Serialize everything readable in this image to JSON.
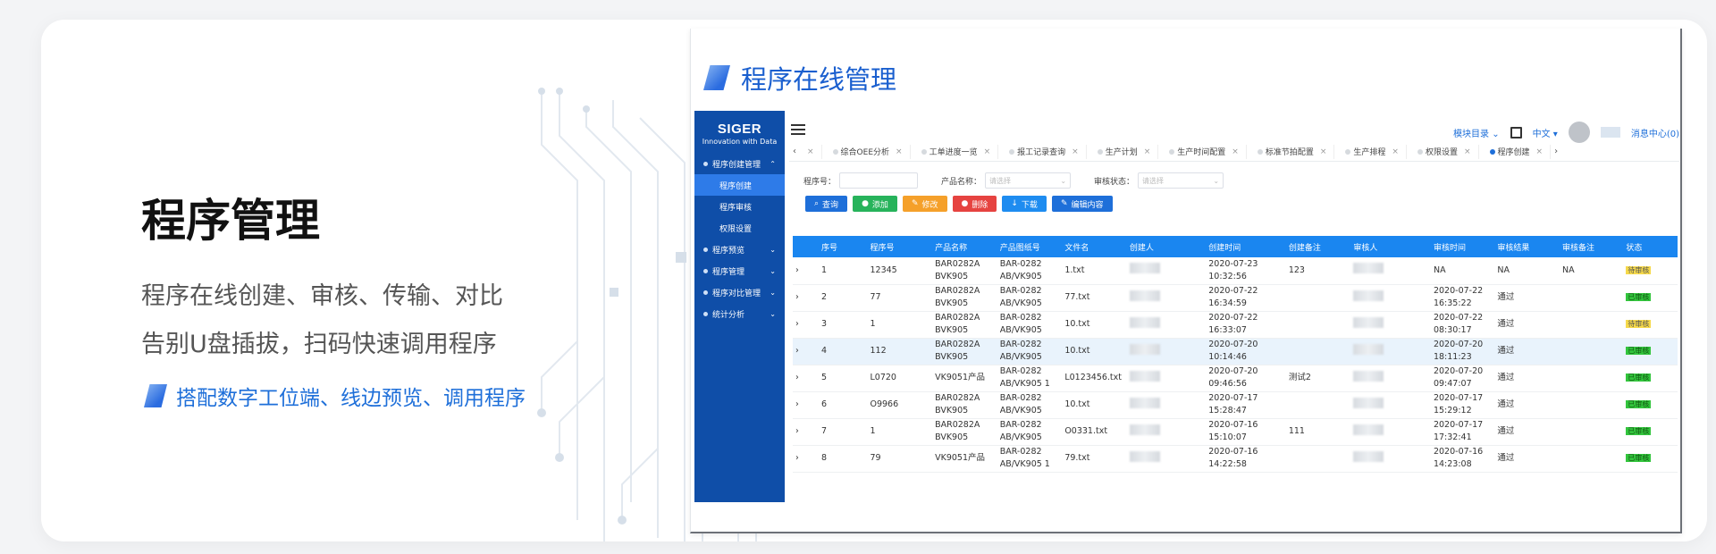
{
  "left": {
    "title": "程序管理",
    "desc_line1": "程序在线创建、审核、传输、对比",
    "desc_line2": "告别U盘插拔，扫码快速调用程序",
    "tagline": "搭配数字工位端、线边预览、调用程序"
  },
  "shot": {
    "title": "程序在线管理",
    "logo_main": "SIGER",
    "logo_sub": "Innovation with Data",
    "sidebar": [
      {
        "label": "程序创建管理",
        "expand": true
      },
      {
        "label": "程序创建",
        "sub": true,
        "active": true
      },
      {
        "label": "程序审核",
        "sub": true
      },
      {
        "label": "权限设置",
        "sub": true
      },
      {
        "label": "程序预览"
      },
      {
        "label": "程序管理"
      },
      {
        "label": "程序对比管理"
      },
      {
        "label": "统计分析"
      }
    ],
    "top_right": {
      "catalog": "模块目录",
      "language": "中文",
      "messages": "消息中心(0)"
    },
    "tabs": [
      "综合OEE分析",
      "工单进度一览",
      "报工记录查询",
      "生产计划",
      "生产时间配置",
      "标准节拍配置",
      "生产排程",
      "权限设置",
      "程序创建"
    ],
    "filters": {
      "program_no_label": "程序号：",
      "product_label": "产品名称：",
      "product_placeholder": "请选择",
      "audit_label": "审核状态：",
      "audit_placeholder": "请选择"
    },
    "buttons": [
      {
        "label": "查询",
        "color": "#1e6fd9",
        "icon": "search-icon"
      },
      {
        "label": "添加",
        "color": "#27b35b",
        "icon": "plus-icon"
      },
      {
        "label": "修改",
        "color": "#f5a02a",
        "icon": "edit-icon"
      },
      {
        "label": "删除",
        "color": "#e64340",
        "icon": "delete-icon"
      },
      {
        "label": "下载",
        "color": "#1e8cf0",
        "icon": "download-icon"
      },
      {
        "label": "编辑内容",
        "color": "#1e6fd9",
        "icon": "pencil-icon"
      }
    ],
    "columns": [
      "序号",
      "程序号",
      "产品名称",
      "产品图纸号",
      "文件名",
      "创建人",
      "创建时间",
      "创建备注",
      "审核人",
      "审核时间",
      "审核结果",
      "审核备注",
      "状态"
    ],
    "rows": [
      {
        "no": "1",
        "prog": "12345",
        "product": "BAR0282A BVK905",
        "drawing": "BAR-0282 AB/VK905",
        "file": "1.txt",
        "created": "2020-07-23 10:32:56",
        "cnote": "123",
        "atime": "NA",
        "result": "NA",
        "anote": "NA",
        "status": "待审核",
        "pending": true
      },
      {
        "no": "2",
        "prog": "77",
        "product": "BAR0282A BVK905",
        "drawing": "BAR-0282 AB/VK905",
        "file": "77.txt",
        "created": "2020-07-22 16:34:59",
        "cnote": "",
        "atime": "2020-07-22 16:35:22",
        "result": "通过",
        "anote": "",
        "status": "已审核",
        "pending": false
      },
      {
        "no": "3",
        "prog": "1",
        "product": "BAR0282A BVK905",
        "drawing": "BAR-0282 AB/VK905",
        "file": "10.txt",
        "created": "2020-07-22 16:33:07",
        "cnote": "",
        "atime": "2020-07-22 08:30:17",
        "result": "通过",
        "anote": "",
        "status": "待审核",
        "pending": true
      },
      {
        "no": "4",
        "prog": "112",
        "product": "BAR0282A BVK905",
        "drawing": "BAR-0282 AB/VK905",
        "file": "10.txt",
        "created": "2020-07-20 10:14:46",
        "cnote": "",
        "atime": "2020-07-20 18:11:23",
        "result": "通过",
        "anote": "",
        "status": "已审核",
        "pending": false
      },
      {
        "no": "5",
        "prog": "L0720",
        "product": "VK9051产品",
        "drawing": "BAR-0282 AB/VK905 1",
        "file": "L0123456.txt",
        "created": "2020-07-20 09:46:56",
        "cnote": "测试2",
        "atime": "2020-07-20 09:47:07",
        "result": "通过",
        "anote": "",
        "status": "已审核",
        "pending": false
      },
      {
        "no": "6",
        "prog": "O9966",
        "product": "BAR0282A BVK905",
        "drawing": "BAR-0282 AB/VK905",
        "file": "10.txt",
        "created": "2020-07-17 15:28:47",
        "cnote": "",
        "atime": "2020-07-17 15:29:12",
        "result": "通过",
        "anote": "",
        "status": "已审核",
        "pending": false
      },
      {
        "no": "7",
        "prog": "1",
        "product": "BAR0282A BVK905",
        "drawing": "BAR-0282 AB/VK905",
        "file": "O0331.txt",
        "created": "2020-07-16 15:10:07",
        "cnote": "111",
        "atime": "2020-07-17 17:32:41",
        "result": "通过",
        "anote": "",
        "status": "已审核",
        "pending": false
      },
      {
        "no": "8",
        "prog": "79",
        "product": "VK9051产品",
        "drawing": "BAR-0282 AB/VK905 1",
        "file": "79.txt",
        "created": "2020-07-16 14:22:58",
        "cnote": "",
        "atime": "2020-07-16 14:23:08",
        "result": "通过",
        "anote": "",
        "status": "已审核",
        "pending": false
      }
    ]
  }
}
